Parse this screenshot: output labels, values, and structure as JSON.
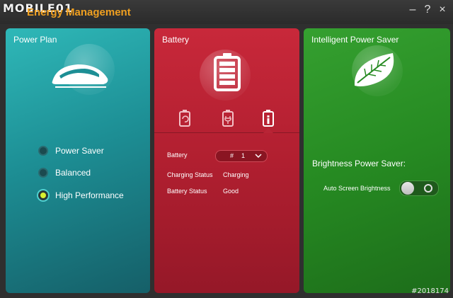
{
  "window": {
    "watermark": "MOBILE01",
    "title": "Energy Management",
    "buttons": {
      "minimize": "–",
      "help": "?",
      "close": "×"
    }
  },
  "power_plan": {
    "title": "Power Plan",
    "options": [
      {
        "label": "Power Saver",
        "selected": false
      },
      {
        "label": "Balanced",
        "selected": false
      },
      {
        "label": "High Performance",
        "selected": true
      }
    ]
  },
  "battery": {
    "title": "Battery",
    "active_tab": 2,
    "fields": {
      "battery_label": "Battery",
      "battery_number_prefix": "#",
      "battery_number": "1",
      "charging_status_label": "Charging Status",
      "charging_status_value": "Charging",
      "battery_status_label": "Battery Status",
      "battery_status_value": "Good"
    }
  },
  "intelligent_power_saver": {
    "title": "Intelligent Power Saver",
    "brightness_title": "Brightness Power Saver:",
    "auto_screen_label": "Auto Screen Brightness",
    "auto_screen_enabled": false
  },
  "footer": {
    "stamp": "#2018174"
  },
  "colors": {
    "accent_title": "#f0a020",
    "power_plan_bg": "#1d8f95",
    "battery_bg": "#b11f30",
    "saver_bg": "#268a22",
    "radio_on": "#d8f030"
  },
  "icons": {
    "app": "app-logo-icon",
    "power_plan": "train-icon",
    "battery": "battery-icon",
    "saver": "leaf-icon"
  }
}
